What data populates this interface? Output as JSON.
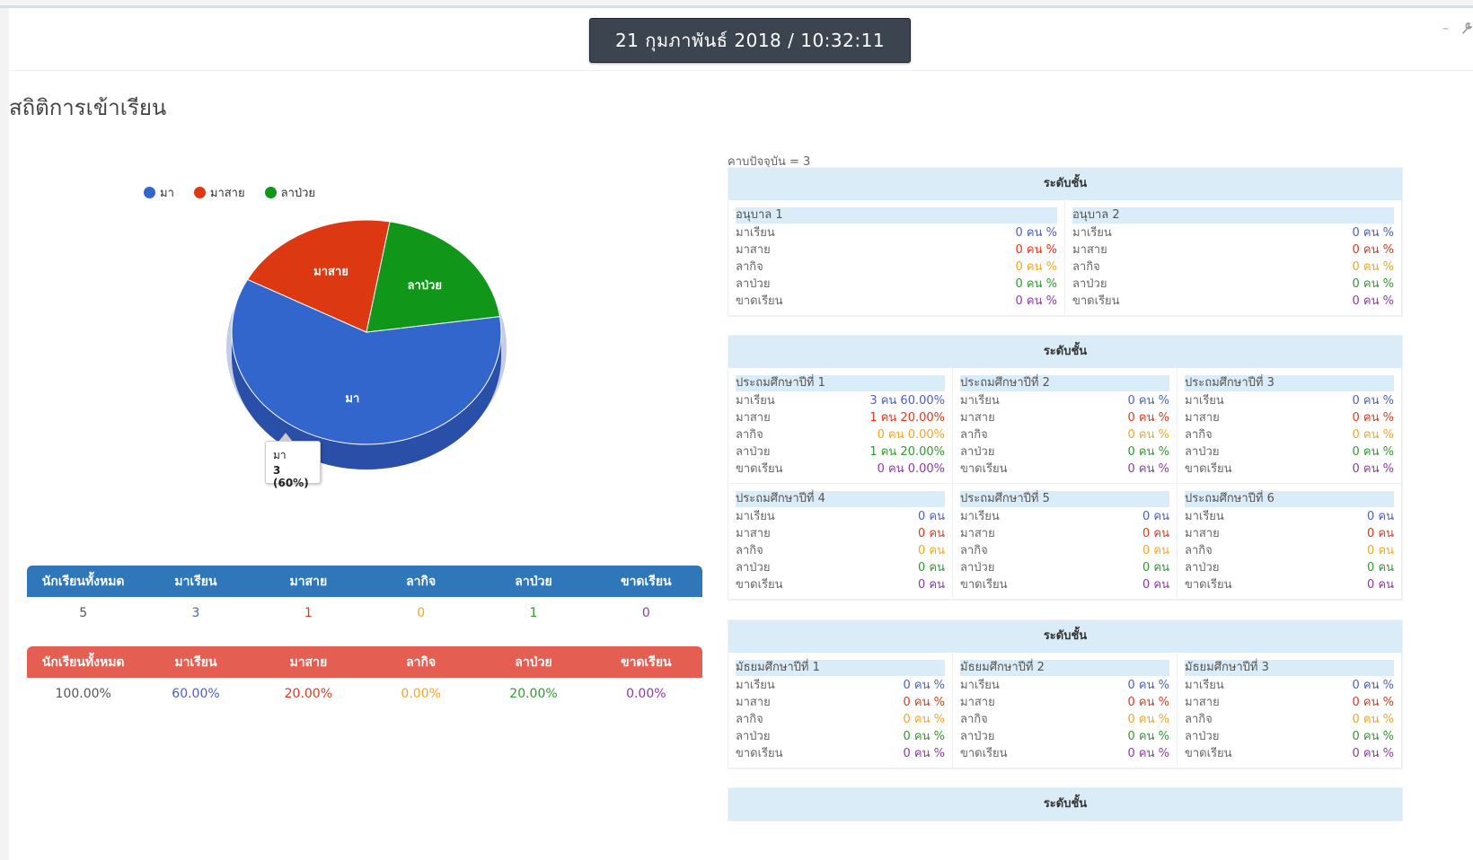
{
  "header": {
    "datetime": "21 กุมภาพันธ์ 2018 / 10:32:11",
    "minimize_icon": "minus-icon",
    "settings_icon": "wrench-icon"
  },
  "page_title": "สถิติการเข้าเรียน",
  "chart_data": {
    "type": "pie",
    "legend_placement": "top-left",
    "legend": [
      "มา",
      "มาสาย",
      "ลาป่วย"
    ],
    "slices": [
      {
        "label": "มา",
        "value": 3,
        "percent": 60,
        "color": "#3366cc"
      },
      {
        "label": "มาสาย",
        "value": 1,
        "percent": 20,
        "color": "#dc3912"
      },
      {
        "label": "ลาป่วย",
        "value": 1,
        "percent": 20,
        "color": "#109618"
      }
    ],
    "tooltip": {
      "label": "มา",
      "value_text": "3 (60%)"
    }
  },
  "count_table": {
    "headers": [
      "นักเรียนทั้งหมด",
      "มาเรียน",
      "มาสาย",
      "ลากิจ",
      "ลาป่วย",
      "ขาดเรียน"
    ],
    "values": [
      "5",
      "3",
      "1",
      "0",
      "1",
      "0"
    ]
  },
  "percent_table": {
    "headers": [
      "นักเรียนทั้งหมด",
      "มาเรียน",
      "มาสาย",
      "ลากิจ",
      "ลาป่วย",
      "ขาดเรียน"
    ],
    "values": [
      "100.00%",
      "60.00%",
      "20.00%",
      "0.00%",
      "20.00%",
      "0.00%"
    ]
  },
  "period_text": "คาบปัจจุบัน = 3",
  "stat_labels": [
    "มาเรียน",
    "มาสาย",
    "ลากิจ",
    "ลาป่วย",
    "ขาดเรียน"
  ],
  "sections": [
    {
      "title": "ระดับชั้น",
      "classes": [
        {
          "name": "อนุบาล 1",
          "values": [
            "0 คน %",
            "0 คน %",
            "0 คน %",
            "0 คน %",
            "0 คน %"
          ]
        },
        {
          "name": "อนุบาล 2",
          "values": [
            "0 คน %",
            "0 คน %",
            "0 คน %",
            "0 คน %",
            "0 คน %"
          ]
        }
      ]
    },
    {
      "title": "ระดับชั้น",
      "classes": [
        {
          "name": "ประถมศึกษาปีที่ 1",
          "values": [
            "3 คน 60.00%",
            "1 คน 20.00%",
            "0 คน 0.00%",
            "1 คน 20.00%",
            "0 คน 0.00%"
          ]
        },
        {
          "name": "ประถมศึกษาปีที่ 2",
          "values": [
            "0 คน %",
            "0 คน %",
            "0 คน %",
            "0 คน %",
            "0 คน %"
          ]
        },
        {
          "name": "ประถมศึกษาปีที่ 3",
          "values": [
            "0 คน %",
            "0 คน %",
            "0 คน %",
            "0 คน %",
            "0 คน %"
          ]
        },
        {
          "name": "ประถมศึกษาปีที่ 4",
          "values": [
            "0 คน",
            "0 คน",
            "0 คน",
            "0 คน",
            "0 คน"
          ]
        },
        {
          "name": "ประถมศึกษาปีที่ 5",
          "values": [
            "0 คน",
            "0 คน",
            "0 คน",
            "0 คน",
            "0 คน"
          ]
        },
        {
          "name": "ประถมศึกษาปีที่ 6",
          "values": [
            "0 คน",
            "0 คน",
            "0 คน",
            "0 คน",
            "0 คน"
          ]
        }
      ]
    },
    {
      "title": "ระดับชั้น",
      "classes": [
        {
          "name": "มัธยมศึกษาปีที่ 1",
          "values": [
            "0 คน %",
            "0 คน %",
            "0 คน %",
            "0 คน %",
            "0 คน %"
          ]
        },
        {
          "name": "มัธยมศึกษาปีที่ 2",
          "values": [
            "0 คน %",
            "0 คน %",
            "0 คน %",
            "0 คน %",
            "0 คน %"
          ]
        },
        {
          "name": "มัธยมศึกษาปีที่ 3",
          "values": [
            "0 คน %",
            "0 คน %",
            "0 คน %",
            "0 คน %",
            "0 คน %"
          ]
        }
      ]
    },
    {
      "title": "ระดับชั้น",
      "classes": []
    }
  ]
}
